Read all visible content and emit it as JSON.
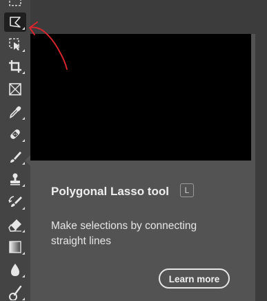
{
  "toolbar": {
    "tools": [
      {
        "name": "rectangular-marquee-tool",
        "icon": "marquee-rect-icon"
      },
      {
        "name": "polygonal-lasso-tool",
        "icon": "polygonal-lasso-icon",
        "selected": true
      },
      {
        "name": "object-selection-tool",
        "icon": "object-selection-icon"
      },
      {
        "name": "crop-tool",
        "icon": "crop-icon"
      },
      {
        "name": "frame-tool",
        "icon": "frame-icon"
      },
      {
        "name": "eyedropper-tool",
        "icon": "eyedropper-icon"
      },
      {
        "name": "spot-healing-brush-tool",
        "icon": "bandage-icon"
      },
      {
        "name": "brush-tool",
        "icon": "brush-icon"
      },
      {
        "name": "clone-stamp-tool",
        "icon": "stamp-icon"
      },
      {
        "name": "history-brush-tool",
        "icon": "history-brush-icon"
      },
      {
        "name": "eraser-tool",
        "icon": "eraser-icon"
      },
      {
        "name": "gradient-tool",
        "icon": "gradient-icon"
      },
      {
        "name": "blur-tool",
        "icon": "drop-icon"
      },
      {
        "name": "dodge-tool",
        "icon": "dodge-icon"
      }
    ]
  },
  "tooltip": {
    "title": "Polygonal Lasso tool",
    "shortcut": "L",
    "description": "Make selections by connecting straight lines",
    "learn_more_label": "Learn more"
  },
  "colors": {
    "panel_bg": "#3c3c3c",
    "toolbar_bg": "#444444",
    "tooltip_bg": "#535353",
    "annotation_red": "#d8262e"
  }
}
